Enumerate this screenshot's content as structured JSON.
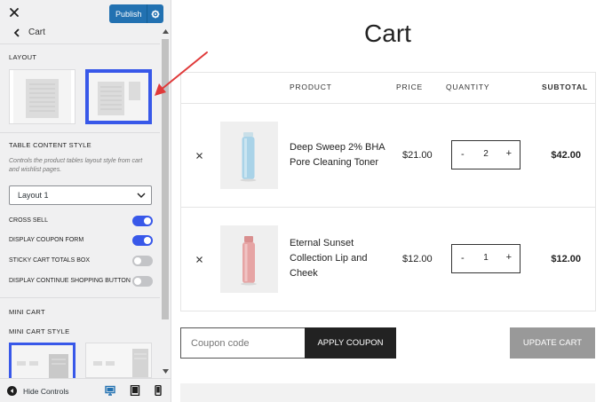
{
  "customizer": {
    "publish_label": "Publish",
    "back_label": "Cart",
    "layout_section": "LAYOUT",
    "table_style_section": "TABLE CONTENT STYLE",
    "table_style_desc": "Controls the product tables layout style from cart and wishlist pages.",
    "table_style_value": "Layout 1",
    "toggles": [
      {
        "label": "CROSS SELL",
        "on": true
      },
      {
        "label": "DISPLAY COUPON FORM",
        "on": true
      },
      {
        "label": "STICKY CART TOTALS BOX",
        "on": false
      },
      {
        "label": "DISPLAY CONTINUE SHOPPING BUTTON",
        "on": false
      }
    ],
    "mini_cart_section": "MINI CART",
    "mini_cart_style_section": "MINI CART STYLE",
    "hide_controls_label": "Hide Controls",
    "accent_color": "#3858e9",
    "publish_color": "#2271b1"
  },
  "preview": {
    "title": "Cart",
    "headers": {
      "product": "PRODUCT",
      "price": "PRICE",
      "quantity": "QUANTITY",
      "subtotal": "SUBTOTAL"
    },
    "items": [
      {
        "name": "Deep Sweep 2% BHA Pore Cleaning Toner",
        "price": "$21.00",
        "quantity": "2",
        "subtotal": "$42.00",
        "thumb_color": "#a9d3e8"
      },
      {
        "name": "Eternal Sunset Collection Lip and Cheek",
        "price": "$12.00",
        "quantity": "1",
        "subtotal": "$12.00",
        "thumb_color": "#e6a4a4"
      }
    ],
    "qty_minus": "-",
    "qty_plus": "+",
    "coupon_placeholder": "Coupon code",
    "apply_coupon_label": "APPLY COUPON",
    "update_cart_label": "UPDATE CART",
    "annotation_color": "#e03a3a"
  }
}
